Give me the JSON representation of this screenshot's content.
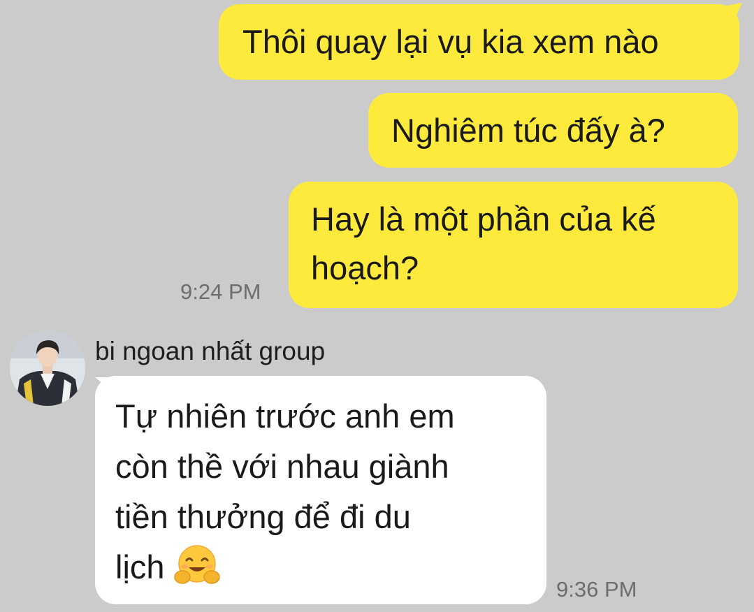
{
  "outgoing": [
    {
      "text": "Thôi quay lại vụ kia xem nào"
    },
    {
      "text": "Nghiêm túc đấy à?"
    },
    {
      "line1": "Hay là một phần của kế",
      "line2": "hoạch?",
      "time": "9:24 PM"
    }
  ],
  "incoming": {
    "sender": "bi ngoan nhất group",
    "avatar_icon": "user-avatar-photo",
    "lines": [
      "Tự nhiên trước anh em",
      "còn thề với nhau giành",
      "tiền thưởng để đi du",
      "lịch"
    ],
    "emoji_icon": "hugging-face-emoji",
    "time": "9:36 PM"
  },
  "colors": {
    "background": "#cbcbcb",
    "outgoing_bubble": "#fee93d",
    "incoming_bubble": "#ffffff",
    "timestamp": "#6d6d6d"
  }
}
